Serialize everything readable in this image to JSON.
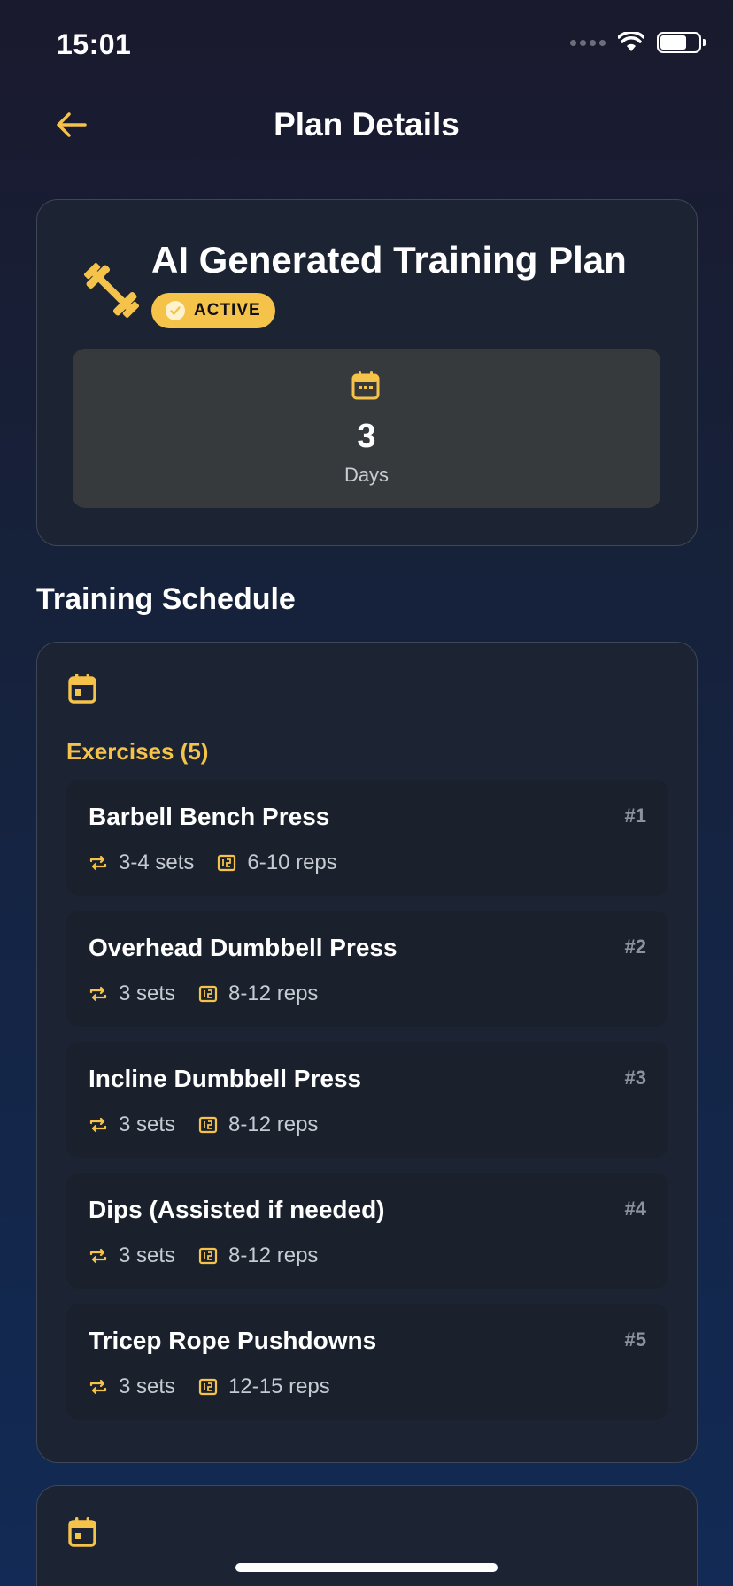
{
  "status_bar": {
    "time": "15:01"
  },
  "nav": {
    "title": "Plan Details"
  },
  "plan": {
    "title": "AI Generated Training Plan",
    "status": "ACTIVE",
    "days_value": "3",
    "days_label": "Days"
  },
  "schedule": {
    "section_title": "Training Schedule",
    "exercises_heading": "Exercises (5)",
    "exercises": [
      {
        "name": "Barbell Bench Press",
        "number": "#1",
        "sets": "3-4 sets",
        "reps": "6-10 reps"
      },
      {
        "name": "Overhead Dumbbell Press",
        "number": "#2",
        "sets": "3 sets",
        "reps": "8-12 reps"
      },
      {
        "name": "Incline Dumbbell Press",
        "number": "#3",
        "sets": "3 sets",
        "reps": "8-12 reps"
      },
      {
        "name": "Dips (Assisted if needed)",
        "number": "#4",
        "sets": "3 sets",
        "reps": "8-12 reps"
      },
      {
        "name": "Tricep Rope Pushdowns",
        "number": "#5",
        "sets": "3 sets",
        "reps": "12-15 reps"
      }
    ]
  },
  "colors": {
    "accent": "#f5c24a",
    "card": "#1c2433",
    "exercise_bg": "#1a212d"
  },
  "icons": {
    "back": "arrow-left-icon",
    "plan": "dumbbell-icon",
    "badge": "check-circle-icon",
    "days": "calendar-icon",
    "sets": "repeat-icon",
    "reps": "numeric-icon"
  }
}
